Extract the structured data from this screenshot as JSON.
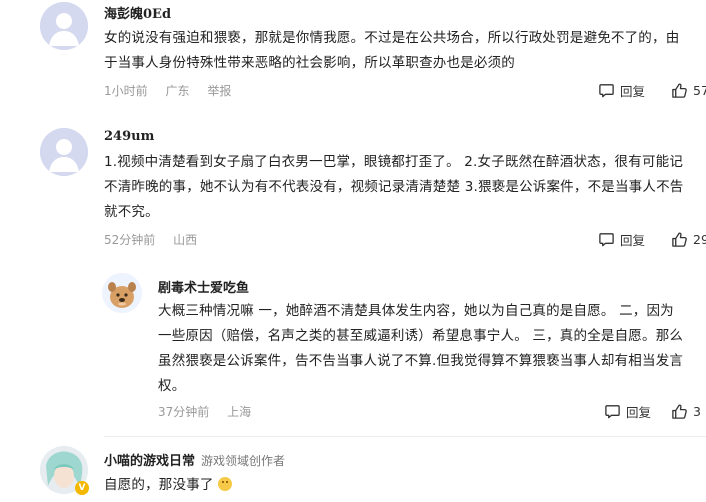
{
  "comments": [
    {
      "username": "海彭魄0Ed",
      "text_lines": [
        "女的说没有强迫和猥亵，那就是你情我愿。不过是在公共场合，所以行政处罚是避免不了的，由",
        "于当事人身份特殊性带来恶略的社会影响，所以革职查办也是必须的"
      ],
      "time": "1小时前",
      "location": "广东",
      "report": "举报",
      "reply_label": "回复",
      "likes": "57"
    },
    {
      "username": "249um",
      "text_lines": [
        "1.视频中清楚看到女子扇了白衣男一巴掌，眼镜都打歪了。 2.女子既然在醉酒状态，很有可能记",
        "不清昨晚的事，她不认为有不代表没有，视频记录清清楚楚 3.猥亵是公诉案件，不是当事人不告",
        "就不究。"
      ],
      "time": "52分钟前",
      "location": "山西",
      "reply_label": "回复",
      "likes": "29"
    },
    {
      "username": "剧毒术士爱吃鱼",
      "text_lines": [
        "大概三种情况嘛 一，她醉酒不清楚具体发生内容，她以为自己真的是自愿。 二，因为",
        "一些原因（赔偿，名声之类的甚至威逼利诱）希望息事宁人。 三，真的全是自愿。那么",
        "虽然猥亵是公诉案件，告不告当事人说了不算.但我觉得算不算猥亵当事人却有相当发言",
        "权。"
      ],
      "time": "37分钟前",
      "location": "上海",
      "reply_label": "回复",
      "likes": "3"
    },
    {
      "username": "小喵的游戏日常",
      "role": "游戏领域创作者",
      "text": "自愿的，那没事了"
    }
  ],
  "colors": {
    "avatar_default": "#d5d9f0",
    "meta_gray": "#999999",
    "text": "#222222"
  },
  "icons": {
    "reply": "comment-bubble-icon",
    "like": "thumbs-up-icon",
    "verified": "v-badge-icon"
  }
}
